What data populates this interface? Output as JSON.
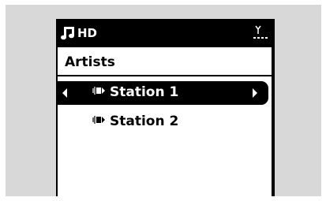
{
  "status_bar": {
    "source_label": "HD",
    "source_icon": "music-note-icon",
    "signal_icon": "antenna-signal-icon"
  },
  "list": {
    "title": "Artists",
    "items": [
      {
        "label": "Station 1",
        "icon": "radio-station-icon",
        "selected": true
      },
      {
        "label": "Station 2",
        "icon": "radio-station-icon",
        "selected": false
      }
    ]
  },
  "colors": {
    "screen_background": "#000000",
    "content_background": "#ffffff",
    "panel_background": "#d8d8d8"
  }
}
